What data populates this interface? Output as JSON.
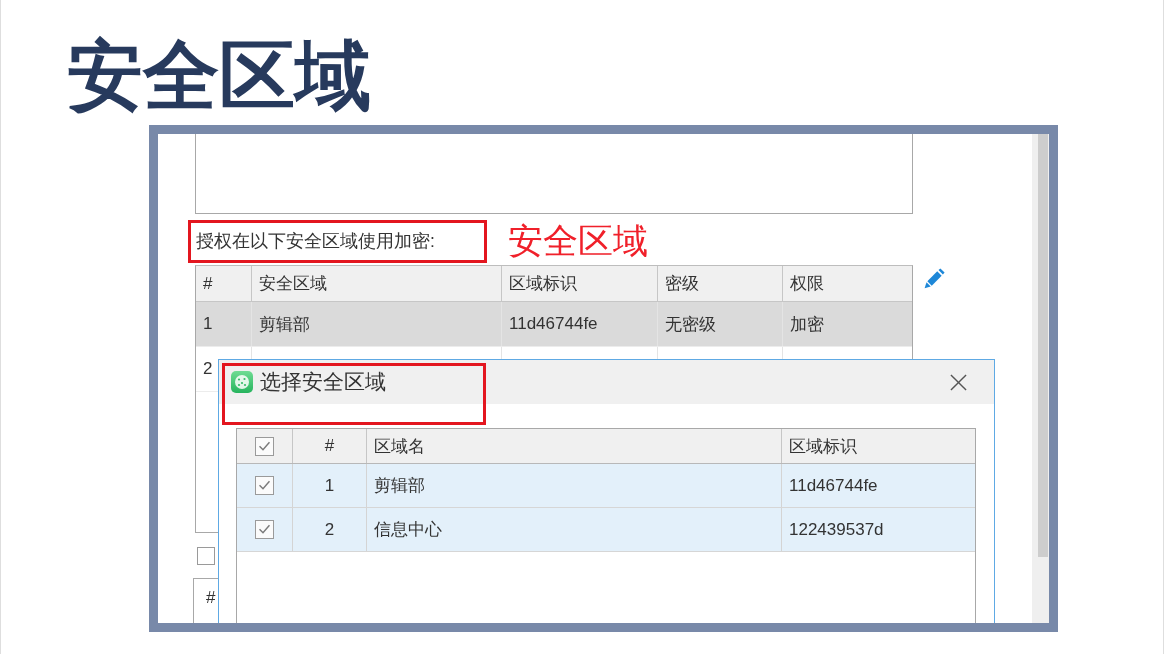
{
  "slide_title": "安全区域",
  "app": {
    "zones_label": "授权在以下安全区域使用加密:",
    "zones_table": {
      "columns": [
        "#",
        "安全区域",
        "区域标识",
        "密级",
        "权限"
      ],
      "rows": [
        {
          "selected": true,
          "cells": [
            "1",
            "剪辑部",
            "11d46744fe",
            "无密级",
            "加密"
          ]
        },
        {
          "selected": false,
          "cells": [
            "2"
          ]
        }
      ]
    },
    "option_checkbox": {
      "checked": false
    },
    "lower_table": {
      "columns": [
        "#"
      ]
    }
  },
  "annotations": {
    "label": "安全区域"
  },
  "dialog": {
    "title": "选择安全区域",
    "table": {
      "select_all": {
        "checked": true
      },
      "columns": [
        "#",
        "区域名",
        "区域标识"
      ],
      "rows": [
        {
          "checked": true,
          "selected": true,
          "cells": [
            "1",
            "剪辑部",
            "11d46744fe"
          ]
        },
        {
          "checked": true,
          "selected": true,
          "cells": [
            "2",
            "信息中心",
            "122439537d"
          ]
        }
      ]
    }
  }
}
